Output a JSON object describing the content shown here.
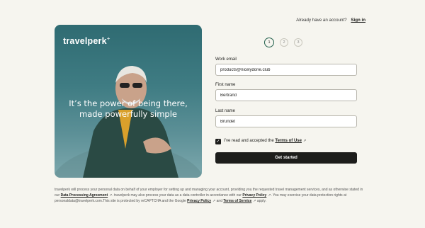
{
  "header": {
    "prompt": "Already have an account?",
    "sign_in": "Sign in"
  },
  "hero": {
    "logo": "travelperk",
    "logo_mark": "+",
    "tagline_1": "It’s the power of being there,",
    "tagline_2": "made powerfully simple"
  },
  "steps": [
    "1",
    "2",
    "3"
  ],
  "form": {
    "email_label": "Work email",
    "email_value": "products@nicelydone.club",
    "first_label": "First name",
    "first_value": "Bertrand",
    "last_label": "Last name",
    "last_value": "Brundet",
    "terms_prefix": "I’ve read and accepted the",
    "terms_link": "Terms of Use",
    "submit": "Get started"
  },
  "footer": {
    "t1": "travelperk will process your personal data on behalf of your employer for setting up and managing your account, providing you the requested travel management services, and as otherwise stated in our",
    "dpa": "Data Processing Agreement",
    "t2": ". travelperk may also process your data as a data controller in accordance with our",
    "privacy": "Privacy Policy",
    "t3": ". You may exercise your data protection rights at personaldata@travelperk.com.This site is protected by reCAPTCHA and the Google",
    "privacy2": "Privacy Policy",
    "t4": "and",
    "tos": "Terms of Service",
    "t5": "apply."
  }
}
